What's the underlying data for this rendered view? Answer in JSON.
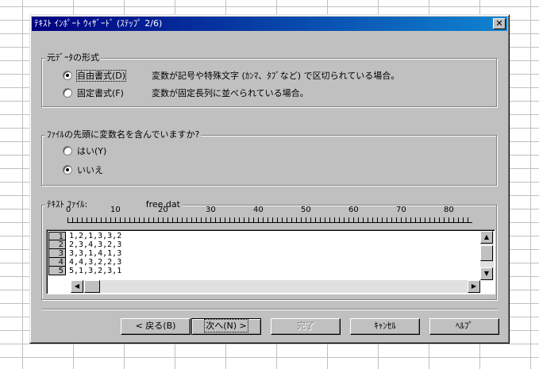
{
  "dialog": {
    "title": "ﾃｷｽﾄ ｲﾝﾎﾟｰﾄ ｳｨｻﾞｰﾄﾞ (ｽﾃｯﾌﾟ 2/6)",
    "close_label": "✕"
  },
  "format_group": {
    "legend": "元ﾃﾞｰﾀの形式",
    "options": [
      {
        "label": "自由書式(D)",
        "description": "変数が記号や特殊文字 (ｶﾝﾏ、ﾀﾌﾞなど) で区切られている場合。",
        "checked": true
      },
      {
        "label": "固定書式(F)",
        "description": "変数が固定長列に並べられている場合。",
        "checked": false
      }
    ]
  },
  "header_group": {
    "legend": "ﾌｧｲﾙの先頭に変数名を含んでいますか?",
    "options": [
      {
        "label": "はい(Y)",
        "checked": false
      },
      {
        "label": "いいえ",
        "checked": true
      }
    ]
  },
  "preview": {
    "legend": "ﾃｷｽﾄ ﾌｧｲﾙ:",
    "filename": "free.dat",
    "ruler": [
      "0",
      "10",
      "20",
      "30",
      "40",
      "50",
      "60",
      "70",
      "80"
    ],
    "line_numbers": [
      "1",
      "2",
      "3",
      "4",
      "5"
    ],
    "lines": [
      "1,2,1,3,3,2",
      "2,3,4,3,2,3",
      "3,3,1,4,1,3",
      "4,4,3,2,2,3",
      "5,1,3,2,3,1"
    ]
  },
  "buttons": {
    "back": "< 戻る(B)",
    "next": "次へ(N) >",
    "finish": "完了",
    "cancel": "ｷｬﾝｾﾙ",
    "help": "ﾍﾙﾌﾟ"
  },
  "colors": {
    "title_start": "#000080",
    "title_end": "#1084d0",
    "face": "#c0c0c0"
  }
}
